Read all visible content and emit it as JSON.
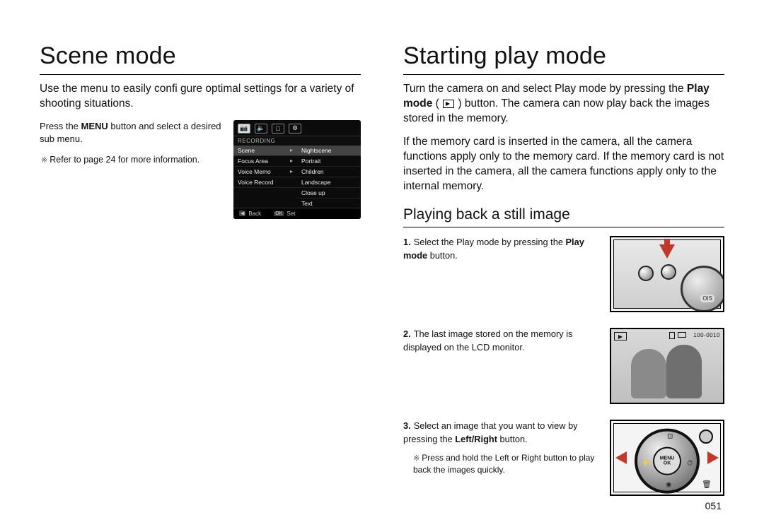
{
  "page_number": "051",
  "left": {
    "title": "Scene mode",
    "intro": "Use the menu to easily confi gure optimal settings for a variety of shooting situations.",
    "press_menu_pre": "Press the ",
    "press_menu_bold": "MENU",
    "press_menu_post": " button and select a desired sub menu.",
    "ref_note": "Refer to page 24 for more information.",
    "lcd": {
      "tabs": [
        "📷",
        "🔈",
        "□",
        "⚙"
      ],
      "header": "RECORDING",
      "left_items": [
        "Scene",
        "Focus Area",
        "Voice Memo",
        "Voice Record"
      ],
      "right_items": [
        "Nightscene",
        "Portrait",
        "Children",
        "Landscape",
        "Close up",
        "Text"
      ],
      "foot_back_key": "◀",
      "foot_back": "Back",
      "foot_set_key": "OK",
      "foot_set": "Set"
    }
  },
  "right": {
    "title": "Starting play mode",
    "intro_1a": "Turn the camera on and select Play mode by pressing the ",
    "intro_1b_bold": "Play mode",
    "intro_1c": " ( ",
    "intro_1d": " ) button. The camera can now play back the images stored in the memory.",
    "intro_2": "If the memory card is inserted in the camera, all the camera functions apply only to the memory card. If the memory card is not inserted in the camera, all the camera functions apply only to the internal memory.",
    "subheading": "Playing back a still image",
    "steps": {
      "s1_num": "1.",
      "s1_a": "Select the Play mode by pressing the ",
      "s1_bold": "Play mode",
      "s1_b": " button.",
      "s2_num": "2.",
      "s2": "The last image stored on the memory is displayed on the LCD monitor.",
      "s3_num": "3.",
      "s3_a": "Select an image that you want to view by pressing the ",
      "s3_bold": "Left/Right",
      "s3_b": " button.",
      "s3_note": "Press and hold the Left or Right button to play back the images quickly."
    },
    "illus2": {
      "file_no": "100-0010",
      "play_glyph": "▶",
      "menu_label_top": "MENU",
      "menu_label_bottom": "OK"
    }
  }
}
